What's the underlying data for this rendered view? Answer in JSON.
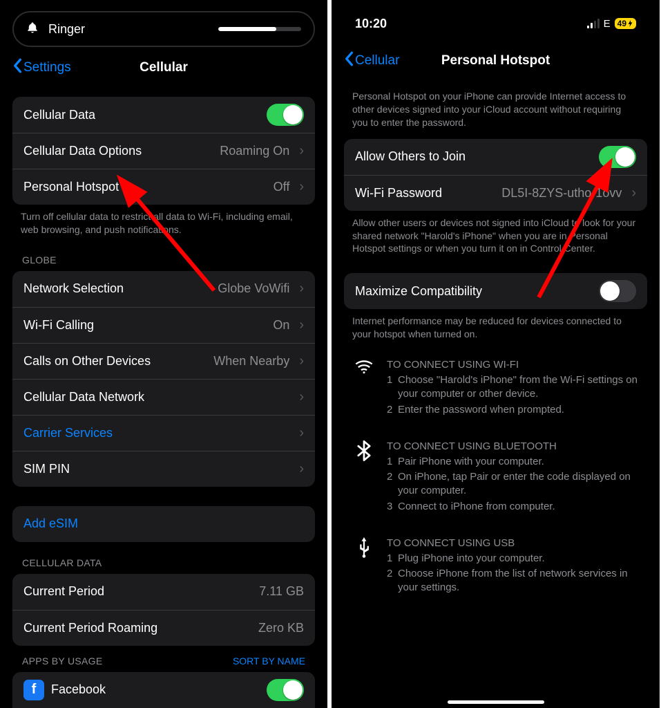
{
  "left": {
    "pill_label": "Ringer",
    "back": "Settings",
    "title": "Cellular",
    "rows1": [
      {
        "label": "Cellular Data",
        "toggle": true
      },
      {
        "label": "Cellular Data Options",
        "value": "Roaming On"
      },
      {
        "label": "Personal Hotspot",
        "value": "Off"
      }
    ],
    "footer1": "Turn off cellular data to restrict all data to Wi-Fi, including email, web browsing, and push notifications.",
    "section2_header": "GLOBE",
    "rows2": [
      {
        "label": "Network Selection",
        "value": "Globe VoWifi"
      },
      {
        "label": "Wi-Fi Calling",
        "value": "On"
      },
      {
        "label": "Calls on Other Devices",
        "value": "When Nearby"
      },
      {
        "label": "Cellular Data Network",
        "value": ""
      },
      {
        "label": "Carrier Services",
        "value": "",
        "link": true
      },
      {
        "label": "SIM PIN",
        "value": ""
      }
    ],
    "add_esim": "Add eSIM",
    "section4_header": "CELLULAR DATA",
    "rows4": [
      {
        "label": "Current Period",
        "value": "7.11 GB"
      },
      {
        "label": "Current Period Roaming",
        "value": "Zero KB"
      }
    ],
    "apps_header": "APPS BY USAGE",
    "sort_label": "SORT BY NAME",
    "app_row": {
      "label": "Facebook"
    }
  },
  "right": {
    "time": "10:20",
    "net_label": "E",
    "battery": "49",
    "back": "Cellular",
    "title": "Personal Hotspot",
    "intro": "Personal Hotspot on your iPhone can provide Internet access to other devices signed into your iCloud account without requiring you to enter the password.",
    "rows1": [
      {
        "label": "Allow Others to Join",
        "toggle": true
      },
      {
        "label": "Wi-Fi Password",
        "value": "DL5I-8ZYS-utho-1ovv"
      }
    ],
    "footer1": "Allow other users or devices not signed into iCloud to look for your shared network \"Harold's iPhone\" when you are in Personal Hotspot settings or when you turn it on in Control Center.",
    "rows2": [
      {
        "label": "Maximize Compatibility",
        "toggle": false
      }
    ],
    "footer2": "Internet performance may be reduced for devices connected to your hotspot when turned on.",
    "instr": [
      {
        "icon": "wifi",
        "cap": "TO CONNECT USING WI-FI",
        "steps": [
          "Choose \"Harold's iPhone\" from the Wi-Fi settings on your computer or other device.",
          "Enter the password when prompted."
        ]
      },
      {
        "icon": "bluetooth",
        "cap": "TO CONNECT USING BLUETOOTH",
        "steps": [
          "Pair iPhone with your computer.",
          "On iPhone, tap Pair or enter the code displayed on your computer.",
          "Connect to iPhone from computer."
        ]
      },
      {
        "icon": "usb",
        "cap": "TO CONNECT USING USB",
        "steps": [
          "Plug iPhone into your computer.",
          "Choose iPhone from the list of network services in your settings."
        ]
      }
    ]
  }
}
